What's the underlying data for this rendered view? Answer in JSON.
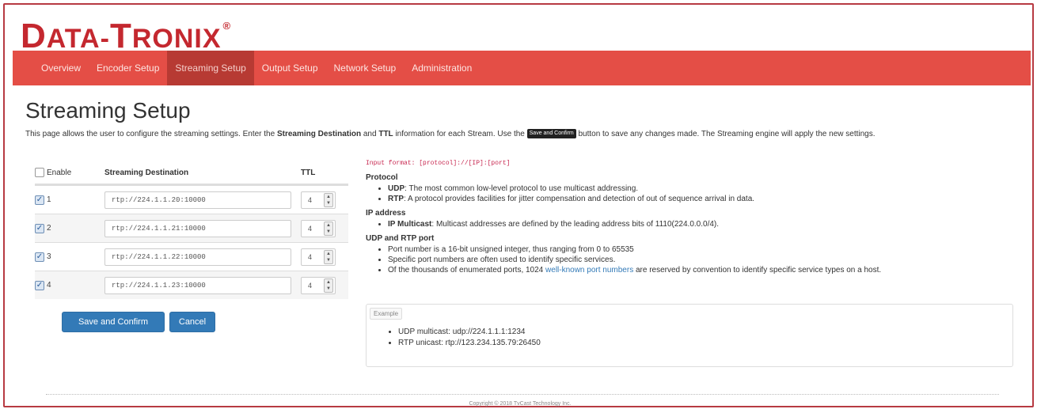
{
  "brand": {
    "logo_d": "D",
    "logo_ata": "ATA-",
    "logo_t": "T",
    "logo_ronix": "RONIX",
    "reg": "®"
  },
  "nav": {
    "items": [
      "Overview",
      "Encoder Setup",
      "Streaming Setup",
      "Output Setup",
      "Network Setup",
      "Administration"
    ],
    "active": "Streaming Setup"
  },
  "page": {
    "title": "Streaming Setup",
    "intro_1": "This page allows the user to configure the streaming settings. Enter the ",
    "intro_b1": "Streaming Destination",
    "intro_2": " and ",
    "intro_b2": "TTL",
    "intro_3": " information for each Stream. Use the ",
    "intro_kbd": "Save and Confirm",
    "intro_4": " button to save any changes made. The Streaming engine will apply the new settings."
  },
  "table": {
    "header_enable": "Enable",
    "header_dest": "Streaming Destination",
    "header_ttl": "TTL",
    "rows": [
      {
        "label": "1",
        "dest": "rtp://224.1.1.20:10000",
        "ttl": "4"
      },
      {
        "label": "2",
        "dest": "rtp://224.1.1.21:10000",
        "ttl": "4"
      },
      {
        "label": "3",
        "dest": "rtp://224.1.1.22:10000",
        "ttl": "4"
      },
      {
        "label": "4",
        "dest": "rtp://224.1.1.23:10000",
        "ttl": "4"
      }
    ]
  },
  "buttons": {
    "save": "Save and Confirm",
    "cancel": "Cancel"
  },
  "info": {
    "format": "Input format: [protocol]://[IP]:[port]",
    "protocol_title": "Protocol",
    "udp_b": "UDP",
    "udp_t": ": The most common low-level protocol to use multicast addressing.",
    "rtp_b": "RTP",
    "rtp_t": ": A protocol provides facilities for jitter compensation and detection of out of sequence arrival in data.",
    "ip_title": "IP address",
    "ip_b": "IP Multicast",
    "ip_t": ": Multicast addresses are defined by the leading address bits of 1110(224.0.0.0/4).",
    "port_title": "UDP and RTP port",
    "port_1": "Port number is a 16-bit unsigned integer, thus ranging from 0 to 65535",
    "port_2": "Specific port numbers are often used to identify specific services.",
    "port_3a": "Of the thousands of enumerated ports, 1024 ",
    "port_3link": "well-known port numbers",
    "port_3b": " are reserved by convention to identify specific service types on a host."
  },
  "example": {
    "tab": "Example",
    "udp": "UDP multicast: udp://224.1.1.1:1234",
    "rtp": "RTP unicast: rtp://123.234.135.79:26450"
  },
  "footer": {
    "copyright": "Copyright © 2018 TvCast Technology Inc."
  },
  "colors": {
    "brand_red": "#c4282f",
    "navbar": "#e44e46",
    "nav_active": "#b73a33",
    "button_blue": "#337ab7"
  }
}
